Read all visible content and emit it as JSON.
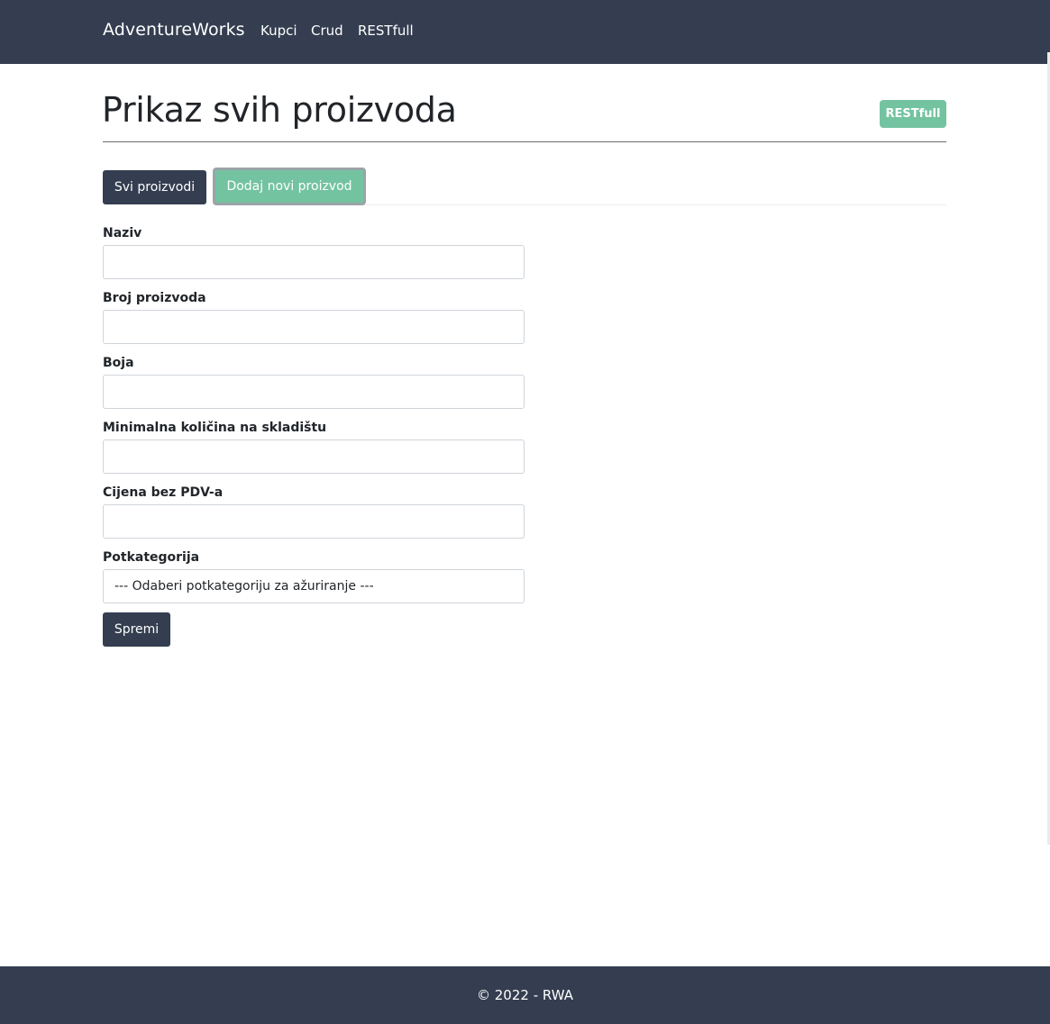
{
  "navbar": {
    "brand": "AdventureWorks",
    "links": [
      "Kupci",
      "Crud",
      "RESTfull"
    ]
  },
  "header": {
    "title": "Prikaz svih proizvoda",
    "badge": "RESTfull"
  },
  "tabs": {
    "all_products": "Svi proizvodi",
    "add_product": "Dodaj novi proizvod"
  },
  "form": {
    "fields": [
      {
        "label": "Naziv",
        "value": ""
      },
      {
        "label": "Broj proizvoda",
        "value": ""
      },
      {
        "label": "Boja",
        "value": ""
      },
      {
        "label": "Minimalna količina na skladištu",
        "value": ""
      },
      {
        "label": "Cijena bez PDV-a",
        "value": ""
      }
    ],
    "subcategory_label": "Potkategorija",
    "subcategory_selected": "--- Odaberi potkategoriju za ažuriranje ---",
    "save_label": "Spremi"
  },
  "footer": {
    "text": "© 2022 - RWA"
  },
  "colors": {
    "navbar": "#343e50",
    "accent_green": "#74c3a0"
  }
}
